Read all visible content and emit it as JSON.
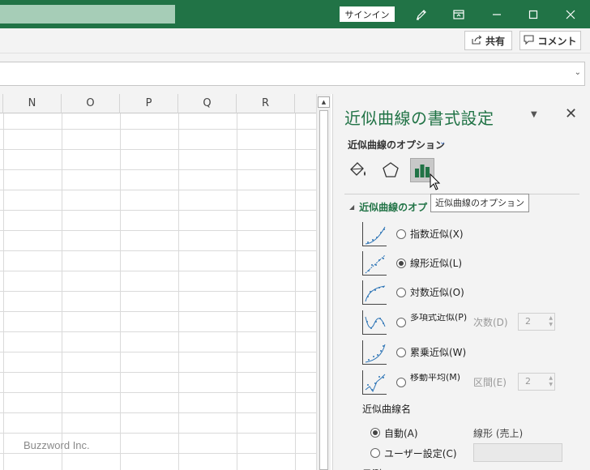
{
  "titlebar": {
    "signin_label": "サインイン",
    "icons": [
      "pen-icon",
      "ribbon-display-icon",
      "minimize-icon",
      "maximize-icon",
      "close-icon"
    ]
  },
  "ribbon": {
    "share_label": "共有",
    "comment_label": "コメント"
  },
  "grid": {
    "columns": [
      "N",
      "O",
      "P",
      "Q",
      "R"
    ]
  },
  "watermark": "Buzzword Inc.",
  "pane": {
    "title": "近似曲線の書式設定",
    "subtitle": "近似曲線のオプション",
    "tooltip": "近似曲線のオプション",
    "section_title": "近似曲線のオプ",
    "trend_types": [
      {
        "label": "指数近似(X)",
        "checked": false
      },
      {
        "label": "線形近似(L)",
        "checked": true
      },
      {
        "label": "対数近似(O)",
        "checked": false
      },
      {
        "label": "多項式近似(P)",
        "checked": false,
        "param_label": "次数(D)",
        "param_value": "2"
      },
      {
        "label": "累乗近似(W)",
        "checked": false
      },
      {
        "label": "移動平均(M)",
        "checked": false,
        "param_label": "区間(E)",
        "param_value": "2"
      }
    ],
    "name_section": {
      "heading": "近似曲線名",
      "auto_label": "自動(A)",
      "auto_value": "線形 (売上)",
      "custom_label": "ユーザー設定(C)",
      "auto_checked": true
    },
    "cut_text": "予測"
  }
}
